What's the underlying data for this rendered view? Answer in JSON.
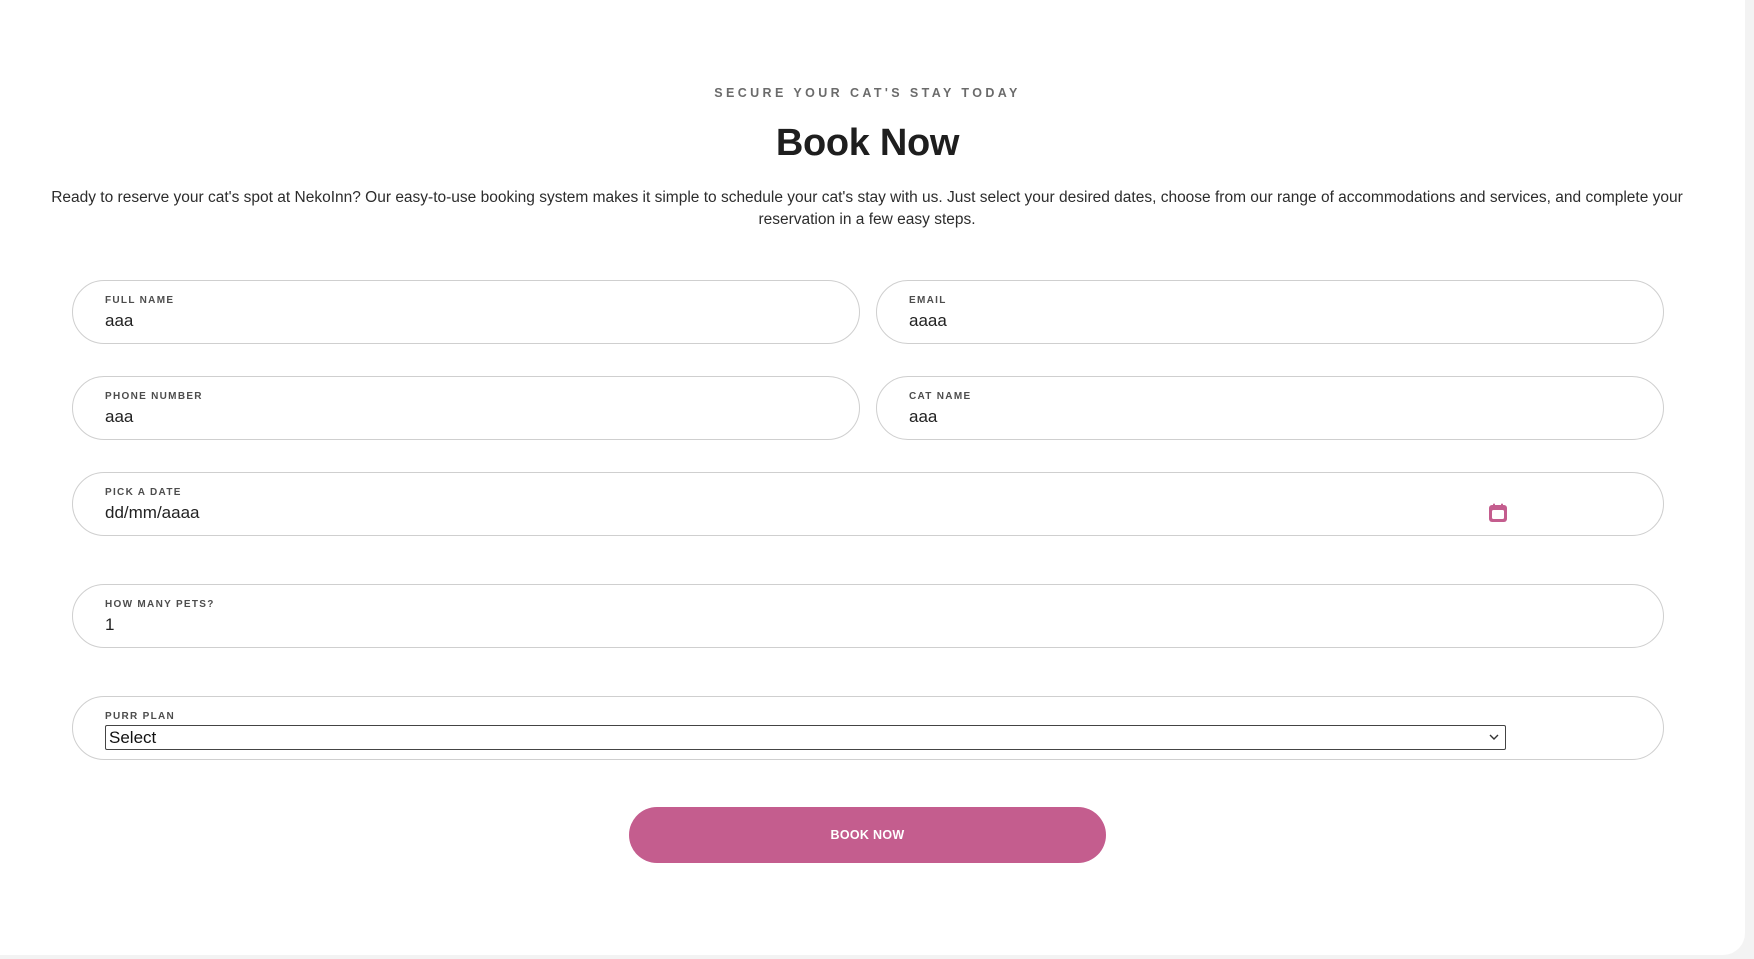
{
  "section": {
    "eyebrow": "SECURE YOUR CAT'S STAY TODAY",
    "title": "Book Now",
    "intro": "Ready to reserve your cat's spot at NekoInn? Our easy-to-use booking system makes it simple to schedule your cat's stay with us. Just select your desired dates, choose from our range of accommodations and services, and complete your reservation in a few easy steps."
  },
  "form": {
    "full_name": {
      "label": "FULL NAME",
      "value": "aaa"
    },
    "email": {
      "label": "EMAIL",
      "value": "aaaa"
    },
    "phone": {
      "label": "PHONE NUMBER",
      "value": "aaa"
    },
    "cat_name": {
      "label": "CAT NAME",
      "value": "aaa"
    },
    "date": {
      "label": "PICK A DATE",
      "value": "dd/mm/aaaa",
      "icon": "calendar-icon"
    },
    "pets": {
      "label": "HOW MANY PETS?",
      "value": "1"
    },
    "plan": {
      "label": "PURR PLAN",
      "selected": "Select",
      "icon": "chevron-down-icon"
    },
    "submit_label": "BOOK NOW"
  },
  "colors": {
    "accent": "#c45d8e",
    "border": "#cfcfcf",
    "text": "#1e1e1e"
  }
}
